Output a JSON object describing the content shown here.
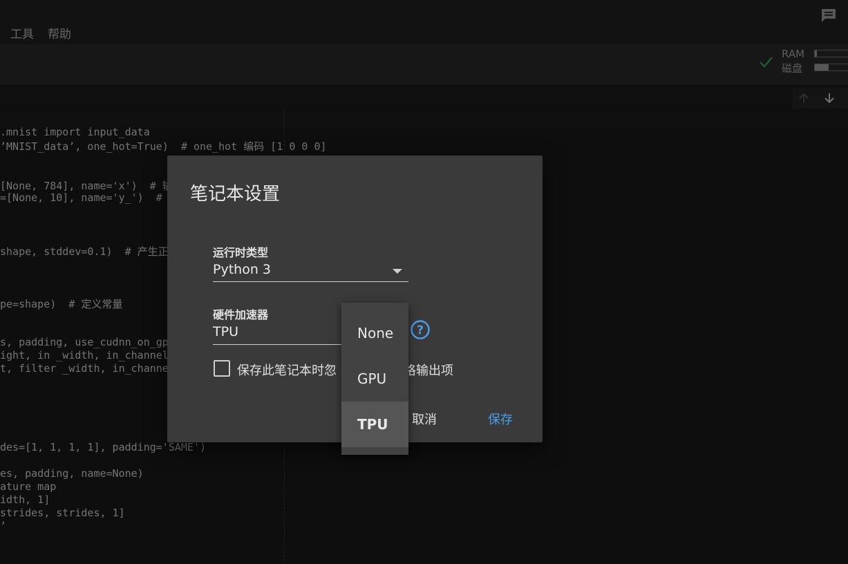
{
  "menubar": {
    "items": [
      {
        "label": "工具"
      },
      {
        "label": "帮助"
      }
    ]
  },
  "resources": {
    "ram_label": "RAM",
    "disk_label": "磁盘",
    "ram_fraction": 0.05,
    "disk_fraction": 0.35,
    "status_color": "#34a853"
  },
  "code": {
    "lines": [
      ".mnist import input_data",
      "’MNIST_data’, one_hot=True)  # one_hot 编码 [1 0 0 0]",
      "[None, 784], name='x')  # 输",
      "=[None, 10], name='y_')  #",
      "shape, stddev=0.1)  # 产生正",
      "pe=shape)  # 定义常量",
      "s, padding, use_cudnn_on_gpu",
      "ight, in _width, in_channel",
      "t, filter _width, in_channe",
      "des=[1, 1, 1, 1], padding='SAME')",
      "es, padding, name=None)",
      "ature map",
      "idth, 1]",
      "strides, strides, 1]",
      "’"
    ]
  },
  "dialog": {
    "title": "笔记本设置",
    "runtime": {
      "label": "运行时类型",
      "value": "Python 3"
    },
    "accelerator": {
      "label": "硬件加速器",
      "value": "TPU",
      "options": [
        "None",
        "GPU",
        "TPU"
      ],
      "selected": "TPU"
    },
    "checkbox_label": "保存此笔记本时忽略代码单元格输出项",
    "checkbox_visible_prefix": "保存此笔记本时忽",
    "checkbox_visible_suffix": "格输出项",
    "cancel_label": "取消",
    "save_label": "保存",
    "accent_color": "#4a9de8"
  }
}
